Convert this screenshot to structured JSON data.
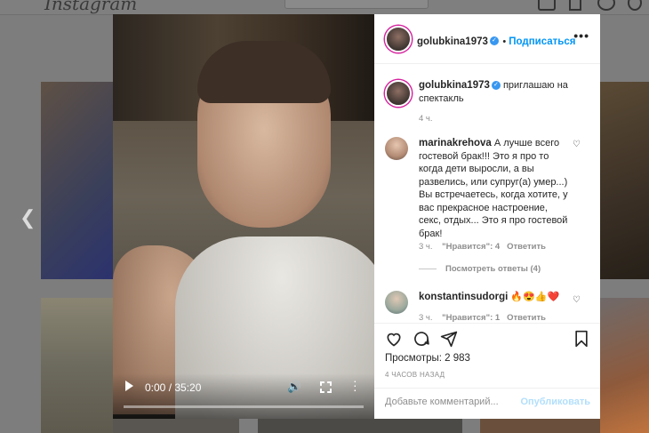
{
  "background": {
    "logo": "Instagram"
  },
  "video": {
    "time": "0:00 / 35:20"
  },
  "post": {
    "header": {
      "username": "golubkina1973",
      "follow_label": "Подписаться"
    },
    "caption": {
      "username": "golubkina1973",
      "text": "приглашаю на спектакль",
      "time": "4 ч."
    },
    "comments": [
      {
        "username": "marinakrehova",
        "text": "А лучше всего гостевой брак!!! Это я про то когда дети выросли, а вы развелись, или супруг(а) умер...) Вы встречаетесь, когда хотите, у вас прекрасное настроение, секс, отдых... Это я про гостевой брак!",
        "time": "3 ч.",
        "likes_label": "\"Нравится\": 4",
        "reply_label": "Ответить",
        "view_replies": "Посмотреть ответы (4)"
      },
      {
        "username": "konstantinsudorgi",
        "text": "🔥😍👍❤️",
        "time": "3 ч.",
        "likes_label": "\"Нравится\": 1",
        "reply_label": "Ответить"
      }
    ],
    "views": "Просмотры: 2 983",
    "posted_ago": "4 ЧАСОВ НАЗАД",
    "add_comment_placeholder": "Добавьте комментарий...",
    "publish_label": "Опубликовать"
  },
  "icons": {
    "heart": "heart-icon",
    "comment": "comment-icon",
    "share": "share-icon",
    "bookmark": "bookmark-icon",
    "prev": "chevron-left-icon"
  },
  "colors": {
    "link": "#0095f6",
    "verified": "#3897f0",
    "muted": "#8e8e8e"
  }
}
